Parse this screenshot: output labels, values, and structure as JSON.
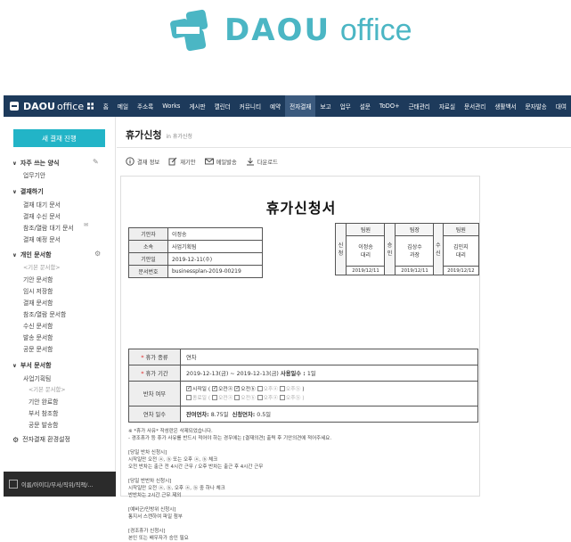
{
  "brand": {
    "name_bold": "DAOU",
    "name_light": "office"
  },
  "topnav": {
    "logo_bold": "DAOU",
    "logo_light": "office",
    "items": [
      "홈",
      "메일",
      "주소록",
      "Works",
      "게시판",
      "캘린더",
      "커뮤니티",
      "예약",
      "전자결재",
      "보고",
      "업무",
      "설문",
      "ToDO+",
      "근태관리",
      "자료실",
      "문서관리",
      "생활백서",
      "문자발송",
      "대여"
    ],
    "active_index": 8
  },
  "sidebar": {
    "new_button": "새 결재 진행",
    "favorites": {
      "title": "자주 쓰는 양식",
      "items": [
        "업무기안"
      ]
    },
    "waiting": {
      "title": "결재하기",
      "items": [
        "결재 대기 문서",
        "결재 수신 문서",
        "참조/열람 대기 문서",
        "결재 예정 문서"
      ]
    },
    "personal": {
      "title": "개인 문서함",
      "sub": "<기본 문서함>",
      "items": [
        "기안 문서함",
        "임시 저장함",
        "결재 문서함",
        "참조/열람 문서함",
        "수신 문서함",
        "발송 문서함",
        "공문 문서함"
      ]
    },
    "dept": {
      "title": "부서 문서함",
      "dept_name": "사업기획팀",
      "sub": "<기본 문서함>",
      "items": [
        "기안 완료함",
        "부서 참조함",
        "공문 발송함"
      ]
    },
    "settings": "전자결재 환경설정",
    "bottom": "이름/아이디/부서/직위/직책/..."
  },
  "page": {
    "title": "휴가신청",
    "crumb": "in 휴가신청"
  },
  "toolbar": [
    "결재 정보",
    "재기안",
    "메일발송",
    "다운로드"
  ],
  "document": {
    "title": "휴가신청서",
    "info": [
      {
        "label": "기안자",
        "value": "이정송"
      },
      {
        "label": "소속",
        "value": "사업기획팀"
      },
      {
        "label": "기안일",
        "value": "2019-12-11(수)"
      },
      {
        "label": "문서번호",
        "value": "businessplan-2019-00219"
      }
    ],
    "approvals": [
      {
        "side": "신청",
        "role": "팀원",
        "name1": "이정송",
        "name2": "대리",
        "date": "2019/12/11"
      },
      {
        "side": "승인",
        "role": "팀장",
        "name1": "김상수",
        "name2": "과장",
        "date": "2019/12/11"
      },
      {
        "side": "수신",
        "role": "팀원",
        "name1": "김민지",
        "name2": "대리",
        "date": "2019/12/12"
      }
    ],
    "leave": {
      "type_label": "휴가 종류",
      "type_value": "연차",
      "period_label": "휴가 기간",
      "period_value": "2019-12-13(금) ~ 2019-12-13(금)",
      "days_label": "사용일수 :",
      "days_value": "1일",
      "half_label": "반차 여부",
      "row1_start": "시작일",
      "row1_end": "종료일",
      "am": "오전",
      "pm": "오후",
      "am_sym": "(",
      "row1_text": "오전반",
      "row1_pm": "오전",
      "count_label": "연차 일수",
      "remain_label": "잔여연차:",
      "remain_value": "8.75일",
      "request_label": "신청연차:",
      "request_value": "0.5일"
    },
    "notes": [
      "※ *휴가 사유* 작성란은 삭제되었습니다.",
      "- 경조휴가 등 휴가 사유를 반드시 적어야 하는 경우에는 [결재의견] 출력 후 기안의견에 적어주세요.",
      "",
      "[당일 반차 신청시]",
      "시작일만 오전 ⓐ, ⓑ 또는 오후 ⓐ, ⓑ 체크",
      "오전 반차는 출근 전 4시간 근무 / 오후 반차는 출근 후 4시간 근무",
      "",
      "[당일 반반차 신청시]",
      "시작일만 오전 ⓐ, ⓑ, 오후 ⓐ, ⓑ 중 하나 체크",
      "반반차는 2시간 근무 제외",
      "",
      "[예비군/민방위 신청시]",
      "통지서 스캔하여 파일 첨부",
      "",
      "[경조휴가 신청시]",
      "본인 또는 배우자가 승인 필요"
    ]
  }
}
